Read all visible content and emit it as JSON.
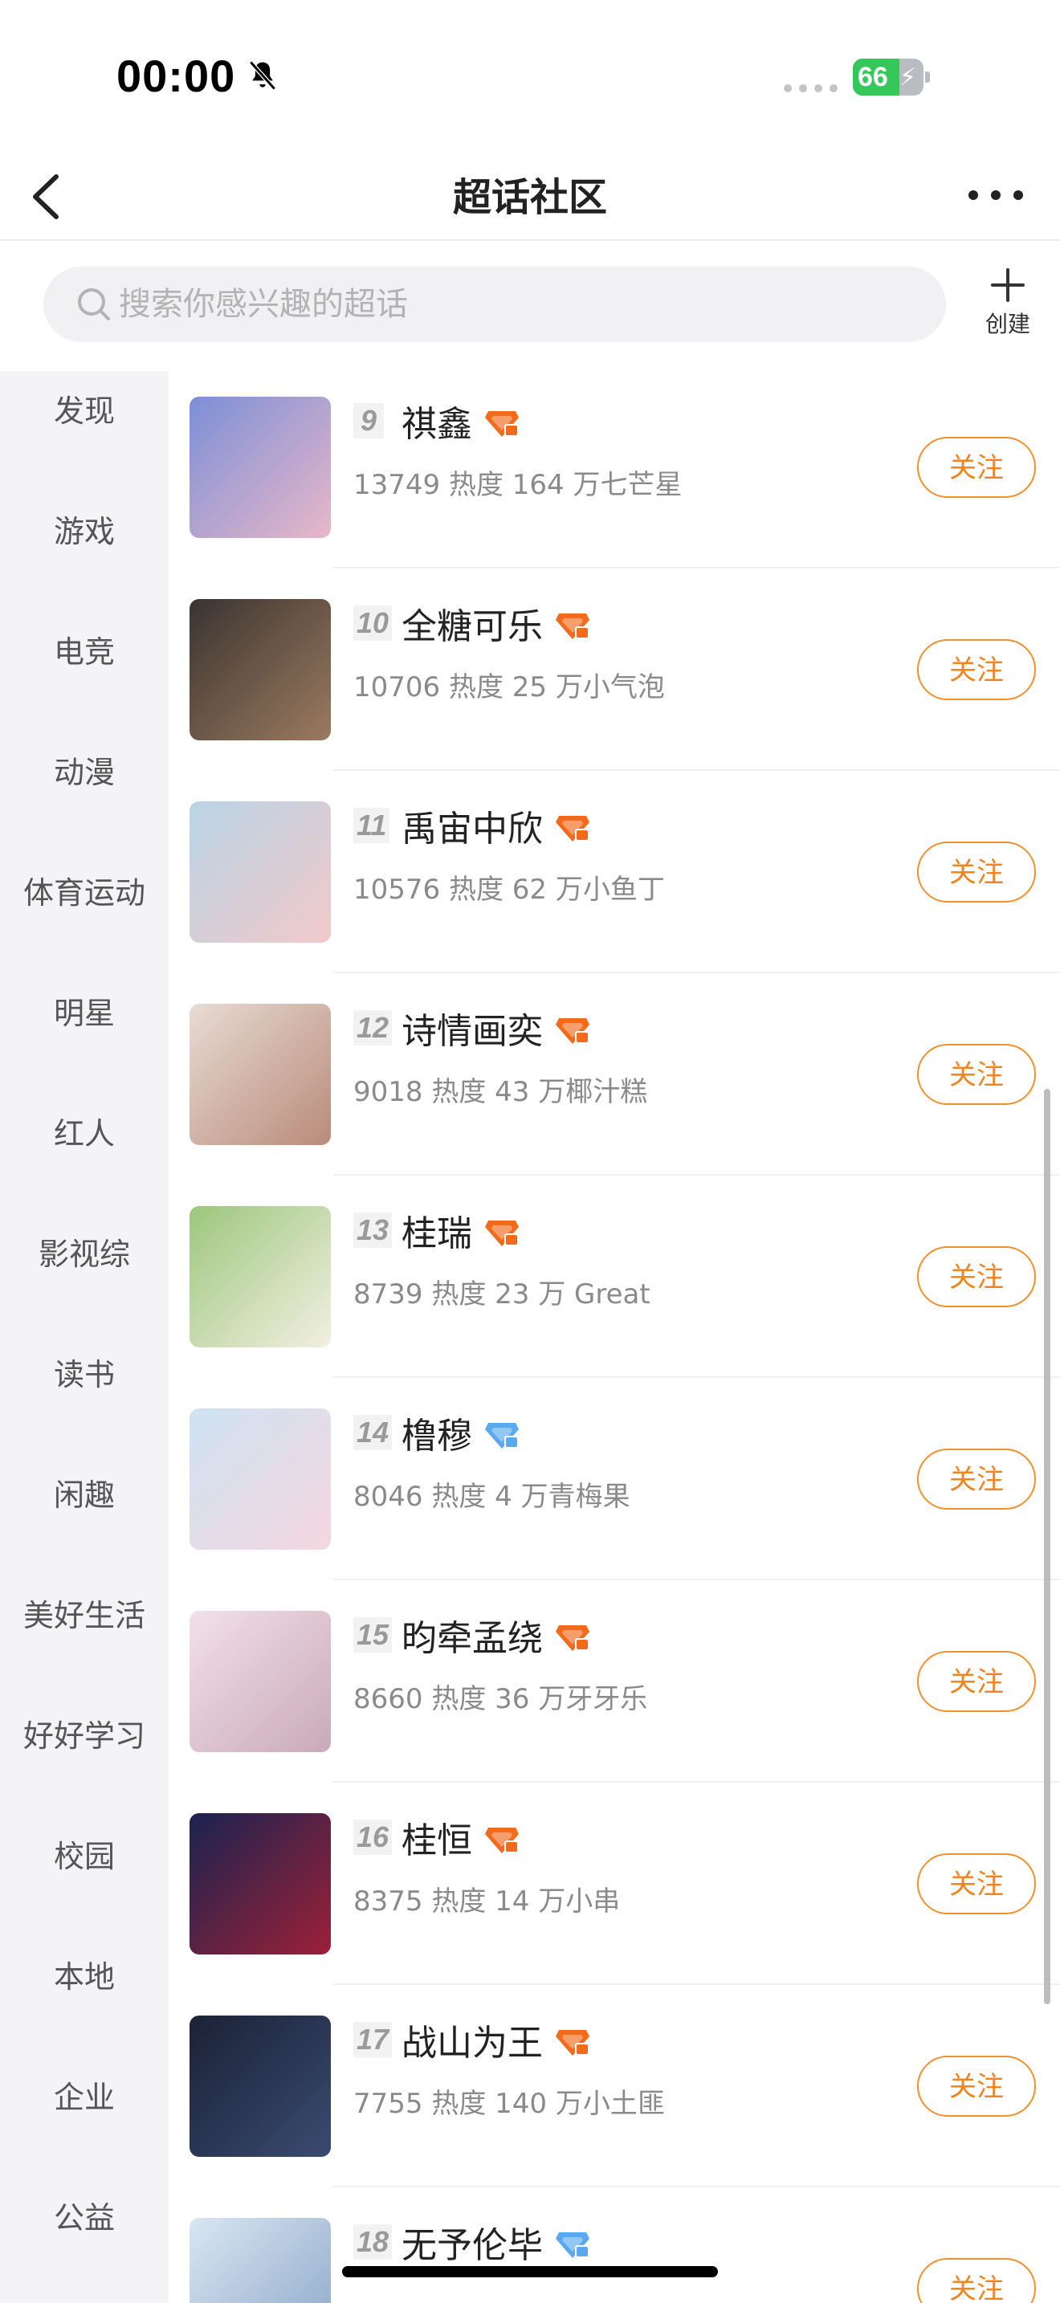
{
  "status_bar": {
    "time": "00:00",
    "battery": "66",
    "battery_level": 0.66
  },
  "nav": {
    "title": "超话社区"
  },
  "search": {
    "placeholder": "搜索你感兴趣的超话",
    "create_label": "创建"
  },
  "sidebar": {
    "items": [
      {
        "label": "发现"
      },
      {
        "label": "游戏"
      },
      {
        "label": "电竞"
      },
      {
        "label": "动漫"
      },
      {
        "label": "体育运动"
      },
      {
        "label": "明星"
      },
      {
        "label": "红人"
      },
      {
        "label": "影视综"
      },
      {
        "label": "读书"
      },
      {
        "label": "闲趣"
      },
      {
        "label": "美好生活"
      },
      {
        "label": "好好学习"
      },
      {
        "label": "校园"
      },
      {
        "label": "本地"
      },
      {
        "label": "企业"
      },
      {
        "label": "公益"
      }
    ]
  },
  "list": {
    "follow_label": "关注",
    "items": [
      {
        "rank": "9",
        "name": "祺鑫",
        "meta": "13749 热度 164 万七芒星",
        "badge": "orange",
        "colors": [
          "#7c8fd8",
          "#e8b7c8"
        ]
      },
      {
        "rank": "10",
        "name": "全糖可乐",
        "meta": "10706 热度 25 万小气泡",
        "badge": "orange",
        "colors": [
          "#3a3430",
          "#9b7a60"
        ]
      },
      {
        "rank": "11",
        "name": "禹宙中欣",
        "meta": "10576 热度 62 万小鱼丁",
        "badge": "orange",
        "colors": [
          "#b9d4e6",
          "#f1c9c9"
        ]
      },
      {
        "rank": "12",
        "name": "诗情画奕",
        "meta": "9018 热度 43 万椰汁糕",
        "badge": "orange",
        "colors": [
          "#e7dcd4",
          "#b98b7a"
        ]
      },
      {
        "rank": "13",
        "name": "桂瑞",
        "meta": "8739 热度 23 万 Great",
        "badge": "orange",
        "colors": [
          "#9cc77c",
          "#f3efe2"
        ]
      },
      {
        "rank": "14",
        "name": "橹穆",
        "meta": "8046 热度 4 万青梅果",
        "badge": "blue",
        "colors": [
          "#cfe3f3",
          "#f4d7df"
        ]
      },
      {
        "rank": "15",
        "name": "昀牵孟绕",
        "meta": "8660 热度 36 万牙牙乐",
        "badge": "orange",
        "colors": [
          "#f2e1e8",
          "#c9a9b8"
        ]
      },
      {
        "rank": "16",
        "name": "桂恒",
        "meta": "8375 热度 14 万小串",
        "badge": "orange",
        "colors": [
          "#1a2350",
          "#9c2038"
        ]
      },
      {
        "rank": "17",
        "name": "战山为王",
        "meta": "7755 热度 140 万小土匪",
        "badge": "orange",
        "colors": [
          "#1b2236",
          "#3a4a70"
        ]
      },
      {
        "rank": "18",
        "name": "无予伦毕",
        "meta": "",
        "badge": "blue",
        "colors": [
          "#d9e6f2",
          "#8aa6c8"
        ]
      }
    ]
  },
  "colors": {
    "accent": "#f08420",
    "badge_orange": "#f26b1d",
    "badge_blue": "#5aa9ef"
  }
}
